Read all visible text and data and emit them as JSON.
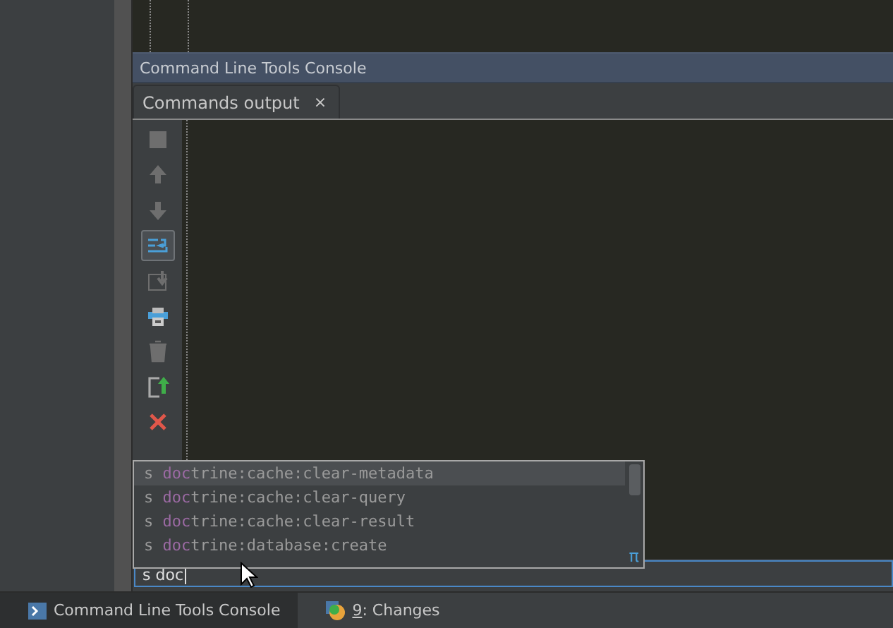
{
  "tool_window": {
    "title": "Command Line Tools Console"
  },
  "tabs": [
    {
      "label": "Commands output",
      "close": "×",
      "selected": true
    }
  ],
  "toolbar": [
    {
      "kind": "stop",
      "on": false
    },
    {
      "kind": "up",
      "on": false
    },
    {
      "kind": "down",
      "on": false
    },
    {
      "kind": "wrap",
      "on": true
    },
    {
      "kind": "scroll",
      "on": false
    },
    {
      "kind": "print",
      "on": false
    },
    {
      "kind": "trash",
      "on": false
    },
    {
      "kind": "export",
      "on": false
    },
    {
      "kind": "close",
      "on": false
    }
  ],
  "completion": {
    "items": [
      {
        "prefix": "s ",
        "match": "doc",
        "rest": "trine:cache:clear-metadata",
        "selected": true
      },
      {
        "prefix": "s ",
        "match": "doc",
        "rest": "trine:cache:clear-query",
        "selected": false
      },
      {
        "prefix": "s ",
        "match": "doc",
        "rest": "trine:cache:clear-result",
        "selected": false
      },
      {
        "prefix": "s ",
        "match": "doc",
        "rest": "trine:database:create",
        "selected": false
      }
    ],
    "hint": "π"
  },
  "command_input": {
    "value": "s doc"
  },
  "status_bar": [
    {
      "label": "Command Line Tools Console",
      "selected": true
    },
    {
      "mnemonic": "9",
      "label": ": Changes",
      "selected": false
    }
  ]
}
